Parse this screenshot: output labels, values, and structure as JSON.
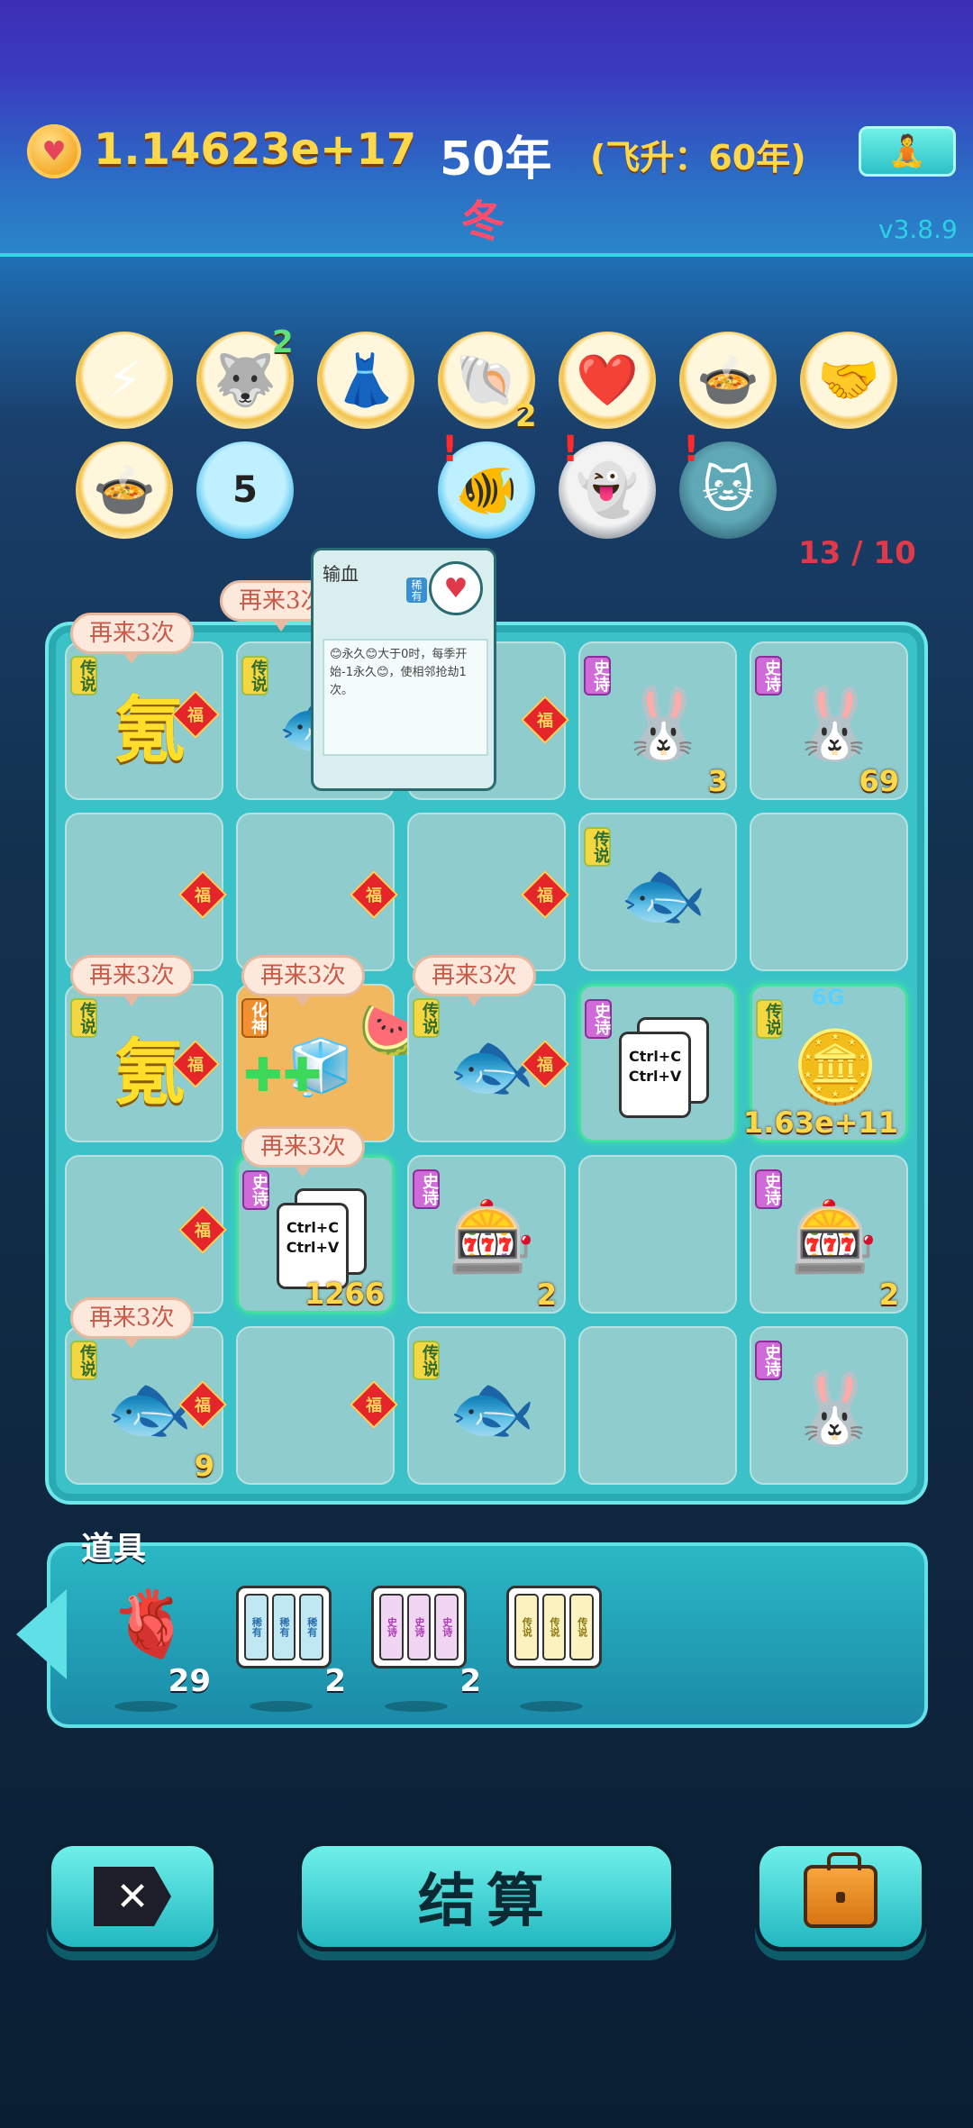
{
  "header": {
    "money": "1.14623e+17",
    "year": "50年",
    "ascend": "(飞升：60年)",
    "season": "冬",
    "version": "v3.8.9"
  },
  "buffs": {
    "row1": [
      {
        "name": "lightning-icon",
        "count": ""
      },
      {
        "name": "husky-icon",
        "count": "2"
      },
      {
        "name": "skirt-icon",
        "count": ""
      },
      {
        "name": "shell-icon",
        "count": "2"
      },
      {
        "name": "heart-blood-icon",
        "count": ""
      },
      {
        "name": "bowl-arrow-icon",
        "count": ""
      },
      {
        "name": "handshake-icon",
        "count": ""
      }
    ],
    "row2": [
      {
        "name": "bowl-arrow-icon",
        "count": ""
      },
      {
        "name": "calendar-icon",
        "count": "5"
      },
      {
        "name": "fishbowl-icon",
        "alert": "!"
      },
      {
        "name": "ghost-icon",
        "alert": "!"
      },
      {
        "name": "cat-couple-icon",
        "alert": "!"
      }
    ],
    "slot_count": "13 / 10"
  },
  "tooltip": {
    "title": "输血",
    "tag": "稀有",
    "body": "😊永久😊大于0时，每季开始-1永久😊，使相邻抢劫1次。"
  },
  "board": {
    "bubble_text": "再来3次",
    "rarity": {
      "legend": "传说",
      "epic": "史诗",
      "god": "化神"
    },
    "fu": "福",
    "kr": "氪",
    "ctrl_c": "Ctrl+C",
    "ctrl_v": "Ctrl+V",
    "counts": {
      "r1c4": "3",
      "r1c5": "69",
      "r3c5_badge": "6G",
      "r3c5": "1.63e+11",
      "r4c2": "1266",
      "r4c3": "2",
      "r4c5": "2",
      "r5c1": "9"
    }
  },
  "props": {
    "label": "道具",
    "items": [
      {
        "name": "liver-item",
        "count": "29"
      },
      {
        "name": "rare-cardset-item",
        "count": "2",
        "tag": "稀有"
      },
      {
        "name": "epic-cardset-item",
        "count": "2",
        "tag": "史诗"
      },
      {
        "name": "legend-cardset-item",
        "count": "",
        "tag": "传说"
      }
    ]
  },
  "buttons": {
    "settle": "结算"
  }
}
